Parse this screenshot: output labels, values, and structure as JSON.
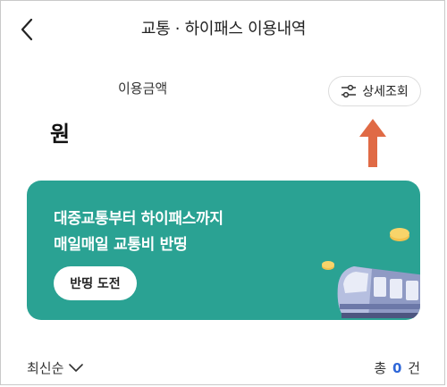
{
  "header": {
    "title": "교통 · 하이패스 이용내역"
  },
  "usage": {
    "label": "이용금액",
    "amount": "원",
    "detail_button": "상세조회"
  },
  "banner": {
    "line1": "대중교통부터 하이패스까지",
    "line2": "매일매일 교통비 반띵",
    "button": "반띵 도전",
    "background_color": "#2aa293"
  },
  "list": {
    "sort_label": "최신순",
    "total_prefix": "총",
    "total_count": "0",
    "total_suffix": "건"
  },
  "colors": {
    "annotation_arrow": "#e06a45",
    "count_blue": "#2f67d8"
  },
  "icons": {
    "back": "chevron-left-icon",
    "detail": "sliders-icon",
    "sort": "chevron-down-icon"
  }
}
